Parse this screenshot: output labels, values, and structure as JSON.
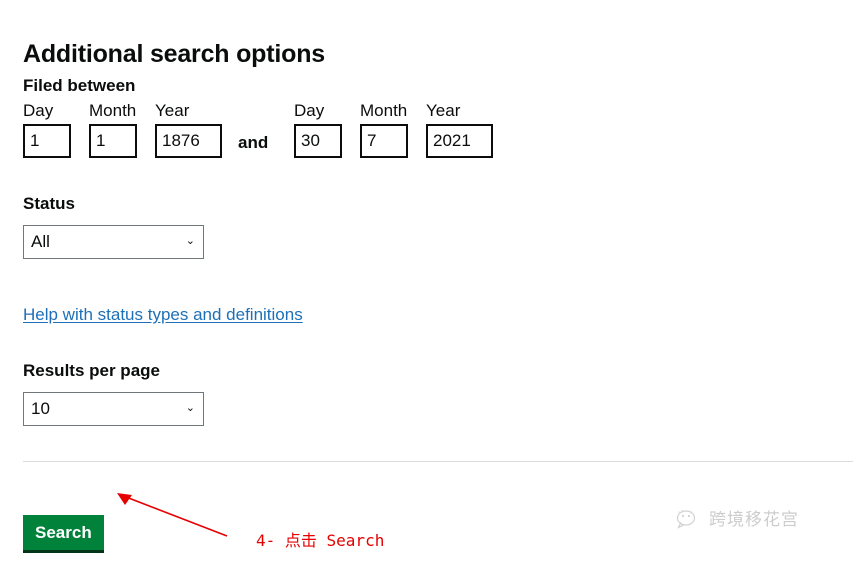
{
  "page": {
    "title": "Additional search options"
  },
  "filed_between": {
    "label": "Filed between",
    "conjunction": "and",
    "from": {
      "day_label": "Day",
      "day_value": "1",
      "month_label": "Month",
      "month_value": "1",
      "year_label": "Year",
      "year_value": "1876"
    },
    "to": {
      "day_label": "Day",
      "day_value": "30",
      "month_label": "Month",
      "month_value": "7",
      "year_label": "Year",
      "year_value": "2021"
    }
  },
  "status": {
    "label": "Status",
    "selected": "All",
    "options": [
      "All"
    ],
    "help_link": "Help with status types and definitions",
    "link_color": "#1d70b8"
  },
  "results_per_page": {
    "label": "Results per page",
    "selected": "10",
    "options": [
      "10"
    ]
  },
  "actions": {
    "search_label": "Search",
    "search_color": "#00823b"
  },
  "annotation": {
    "text": "4- 点击 Search",
    "color": "#e60000"
  },
  "watermark": {
    "text": "跨境移花宫",
    "icon": "wechat-icon"
  },
  "icons": {
    "chevron_down": "⌄"
  }
}
